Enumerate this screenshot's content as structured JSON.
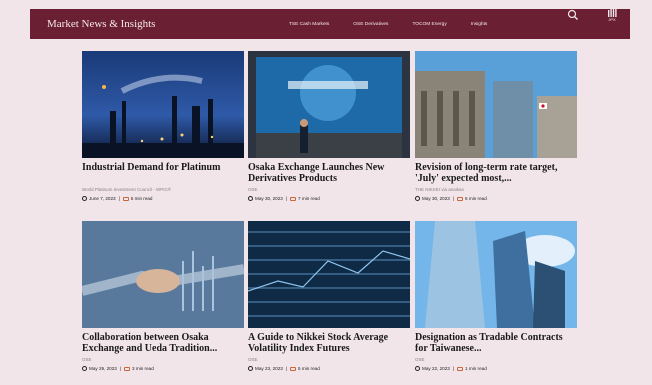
{
  "header": {
    "brand": "Market News & Insights",
    "nav": [
      "TSE Cash Markets",
      "OSE Derivatives",
      "TOCOM Energy",
      "Insights"
    ],
    "search_icon": "search-icon",
    "logo_text": "JPX"
  },
  "articles": [
    {
      "title": "Industrial Demand for Platinum",
      "source": "World Platinum Investment Council - WPIC®",
      "date": "June 7, 2023",
      "read": "5 min read",
      "image": "refinery-night-image"
    },
    {
      "title": "Osaka Exchange Launches New Derivatives Products",
      "source": "OSE",
      "date": "May 30, 2023",
      "read": "7 min read",
      "image": "stage-screen-image"
    },
    {
      "title": "Revision of long-term rate target, 'July' expected most,...",
      "source": "THE NIKKEI via anaikan",
      "date": "May 30, 2023",
      "read": "6 min read",
      "image": "bank-building-image"
    },
    {
      "title": "Collaboration between Osaka Exchange and Ueda Tradition...",
      "source": "OSE",
      "date": "May 29, 2023",
      "read": "3 min read",
      "image": "handshake-image"
    },
    {
      "title": "A Guide to Nikkei Stock Average Volatility Index Futures",
      "source": "OSE",
      "date": "May 23, 2023",
      "read": "5 min read",
      "image": "data-screen-image"
    },
    {
      "title": "Designation as Tradable Contracts for Taiwanese...",
      "source": "OSE",
      "date": "May 22, 2023",
      "read": "1 min read",
      "image": "skyscraper-image"
    }
  ],
  "colors": {
    "header_bg": "#6b1f33",
    "page_bg": "#f1e5ea",
    "accent": "#c9663b"
  }
}
